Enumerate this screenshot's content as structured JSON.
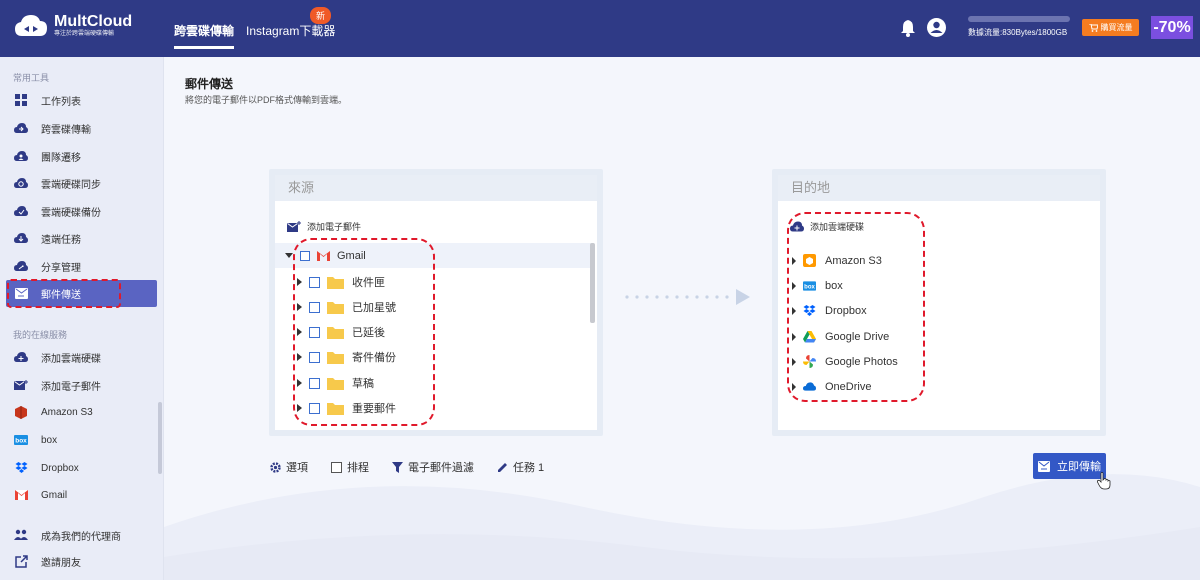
{
  "app": {
    "name": "MultCloud",
    "tagline": "專注於跨雲端硬碟傳輸"
  },
  "topnav": {
    "tabs": [
      "跨雲碟傳輸",
      "Instagram下載器"
    ],
    "new_badge": "新",
    "traffic_text": "數據流量:830Bytes/1800GB",
    "traffic_used_fraction": 0.001,
    "buy_label": "購買流量",
    "discount": "-70%"
  },
  "sidebar": {
    "section_tools": "常用工具",
    "tools": [
      {
        "label": "工作列表",
        "icon": "grid-icon"
      },
      {
        "label": "跨雲碟傳輸",
        "icon": "cloud-transfer-icon"
      },
      {
        "label": "團隊遷移",
        "icon": "cloud-team-icon"
      },
      {
        "label": "雲端硬碟同步",
        "icon": "cloud-sync-icon"
      },
      {
        "label": "雲端硬碟備份",
        "icon": "cloud-backup-icon"
      },
      {
        "label": "遠端任務",
        "icon": "cloud-download-icon"
      },
      {
        "label": "分享管理",
        "icon": "cloud-share-icon"
      },
      {
        "label": "郵件傳送",
        "icon": "email-transfer-icon",
        "active": true
      }
    ],
    "section_services": "我的在線服務",
    "services": [
      {
        "label": "添加雲端硬碟",
        "icon": "add-cloud-icon"
      },
      {
        "label": "添加電子郵件",
        "icon": "add-email-icon"
      },
      {
        "label": "Amazon S3",
        "icon": "amazon-s3-icon"
      },
      {
        "label": "box",
        "icon": "box-icon"
      },
      {
        "label": "Dropbox",
        "icon": "dropbox-icon"
      },
      {
        "label": "Gmail",
        "icon": "gmail-icon"
      }
    ],
    "bottom": [
      {
        "label": "成為我們的代理商",
        "icon": "partner-icon"
      },
      {
        "label": "邀請朋友",
        "icon": "invite-icon"
      }
    ]
  },
  "page": {
    "title": "郵件傳送",
    "subtitle": "將您的電子郵件以PDF格式傳輸到雲端。"
  },
  "source": {
    "header": "來源",
    "add_label": "添加電子郵件",
    "root": "Gmail",
    "folders": [
      "收件匣",
      "已加星號",
      "已延後",
      "寄件備份",
      "草稿",
      "重要郵件"
    ]
  },
  "destination": {
    "header": "目的地",
    "add_label": "添加雲端硬碟",
    "clouds": [
      "Amazon S3",
      "box",
      "Dropbox",
      "Google Drive",
      "Google Photos",
      "OneDrive"
    ]
  },
  "options": {
    "settings": "選項",
    "schedule": "排程",
    "filter": "電子郵件過濾",
    "task": "任務 1"
  },
  "transfer_button": "立即傳輸"
}
